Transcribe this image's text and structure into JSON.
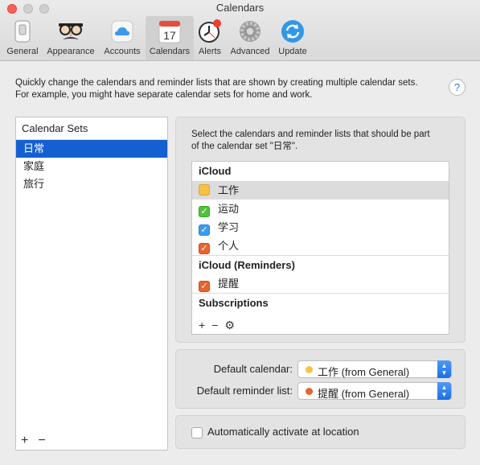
{
  "window": {
    "title": "Calendars"
  },
  "toolbar": {
    "items": [
      {
        "label": "General",
        "icon": "general-icon"
      },
      {
        "label": "Appearance",
        "icon": "appearance-icon"
      },
      {
        "label": "Accounts",
        "icon": "accounts-icon"
      },
      {
        "label": "Calendars",
        "icon": "calendars-icon",
        "selected": true,
        "day": "17"
      },
      {
        "label": "Alerts",
        "icon": "alerts-icon"
      },
      {
        "label": "Advanced",
        "icon": "advanced-icon"
      },
      {
        "label": "Update",
        "icon": "update-icon"
      }
    ]
  },
  "description": {
    "line1": "Quickly change the calendars and reminder lists that are shown by creating multiple calendar sets.",
    "line2": "For example, you might have separate calendar sets for home and work."
  },
  "help": {
    "label": "?"
  },
  "calendar_sets": {
    "header": "Calendar Sets",
    "items": [
      "日常",
      "家庭",
      "旅行"
    ],
    "selected_index": 0,
    "add_label": "+",
    "remove_label": "−"
  },
  "selection": {
    "description_line1": "Select the calendars and reminder lists that should be part",
    "description_line2": "of the calendar set \"日常\".",
    "sections": [
      {
        "title": "iCloud",
        "items": [
          {
            "name": "工作",
            "checked": false,
            "color": "#f7c244"
          },
          {
            "name": "运动",
            "checked": true,
            "color": "#4fc23a"
          },
          {
            "name": "学习",
            "checked": true,
            "color": "#3a9cf0"
          },
          {
            "name": "个人",
            "checked": true,
            "color": "#e8632f"
          }
        ]
      },
      {
        "title": "iCloud (Reminders)",
        "items": [
          {
            "name": "提醒",
            "checked": true,
            "color": "#e8632f"
          }
        ]
      },
      {
        "title": "Subscriptions",
        "items": []
      }
    ],
    "tools": {
      "add": "+",
      "remove": "−",
      "settings": "⚙"
    }
  },
  "defaults": {
    "calendar_label": "Default calendar:",
    "calendar_value": "工作 (from General)",
    "calendar_color": "#f7c244",
    "reminder_label": "Default reminder list:",
    "reminder_value": "提醒 (from General)",
    "reminder_color": "#e8632f"
  },
  "auto_activate": {
    "label": "Automatically activate at location",
    "checked": false
  }
}
